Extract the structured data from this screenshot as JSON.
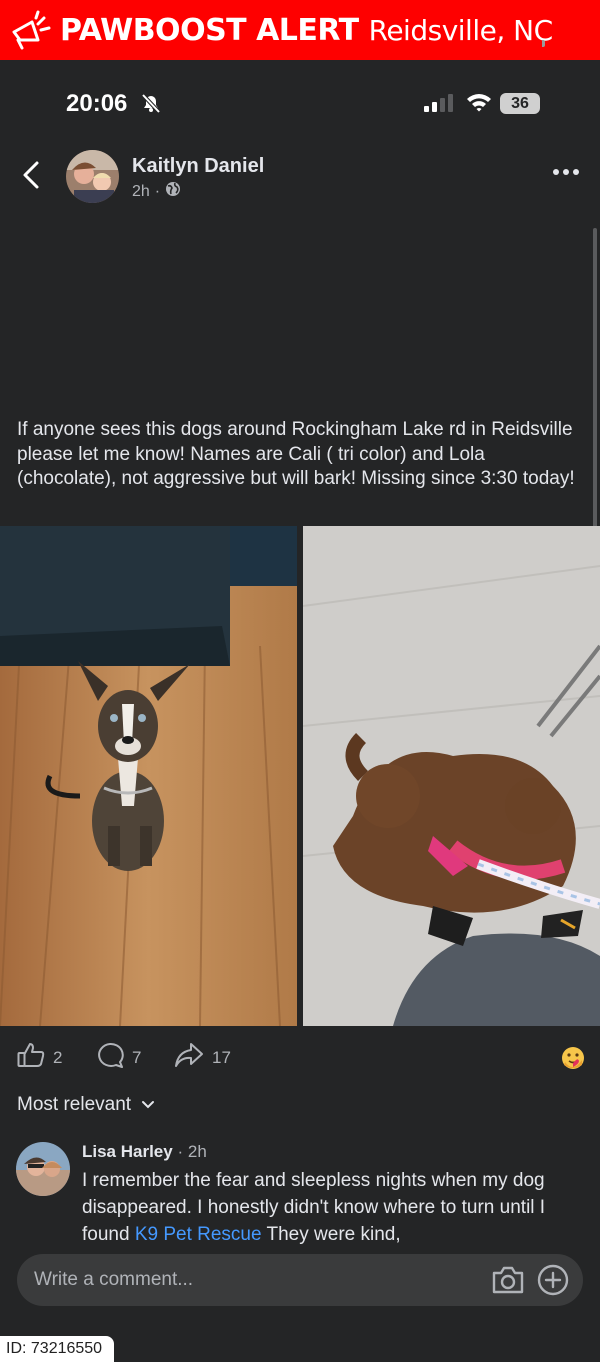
{
  "banner": {
    "title": "PAWBOOST ALERT",
    "location": "Reidsville, NC",
    "icon": "megaphone-icon",
    "color": "#fe0000"
  },
  "status_bar": {
    "time": "20:06",
    "battery": "36",
    "icons": [
      "silent-bell-icon",
      "cell-signal-icon",
      "wifi-icon",
      "battery-icon"
    ]
  },
  "post": {
    "author": "Kaitlyn Daniel",
    "time": "2h",
    "separator": "·",
    "privacy_icon": "globe-icon",
    "text": "If anyone sees this dogs around Rockingham Lake rd in Reidsville please let me know! Names are Cali ( tri color) and Lola (chocolate), not aggressive but will bark!  Missing since 3:30 today!",
    "photos": [
      "brindle dog sitting on wooden floor",
      "brown curly dog with pink harness"
    ]
  },
  "actions": {
    "likes": "2",
    "comments": "7",
    "shares": "17",
    "reaction_icon": "care-emoji-icon"
  },
  "comments_sort": {
    "label": "Most relevant"
  },
  "comment": {
    "author": "Lisa Harley",
    "time": "2h",
    "text_before": "I remember the fear and sleepless nights when my dog disappeared. I honestly didn't know where to turn until I found ",
    "link": "K9 Pet Rescue",
    "text_after": " They were kind,"
  },
  "composer": {
    "placeholder": "Write a comment..."
  },
  "footer": {
    "id_label": "ID: 73216550"
  },
  "colors": {
    "background": "#242526",
    "text": "#e4e6eb",
    "secondary": "#b0b3b8",
    "link": "#4599ff",
    "composer": "#3a3b3c"
  }
}
